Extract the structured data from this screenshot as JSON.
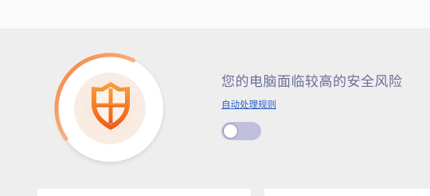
{
  "status": {
    "risk_title": "您的电脑面临较高的安全风险",
    "rules_link": "自动处理规则",
    "auto_handle_toggle": false
  },
  "gauge": {
    "level": 0.42,
    "arc_color_start": "#f8b27a",
    "arc_color_end": "#f5803a",
    "shield_color": "#f37a1d"
  },
  "colors": {
    "background": "#efeeef",
    "title_text": "#6a6f99",
    "link": "#2d63c6",
    "toggle_track": "#c0c0dc"
  }
}
